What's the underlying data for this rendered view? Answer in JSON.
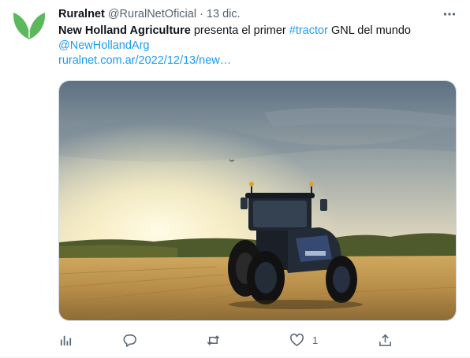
{
  "tweet": {
    "author_name": "Ruralnet",
    "handle": "@RuralNetOficial",
    "separator": "·",
    "date": "13 dic.",
    "text": {
      "bold": "New Holland Agriculture",
      "part1": " presenta el primer ",
      "hashtag": "#tractor",
      "part2": " GNL del mundo",
      "mention": "@NewHollandArg",
      "link": "ruralnet.com.ar/2022/12/13/new…"
    },
    "image_description_icon": "tractor-photo",
    "actions": {
      "like_count": "1"
    }
  },
  "colors": {
    "brand_green": "#5cb85c",
    "link_blue": "#1d9bf0",
    "muted": "#536471"
  },
  "icons": [
    "ruralnet-logo",
    "more-icon",
    "analytics-icon",
    "reply-icon",
    "retweet-icon",
    "like-icon",
    "share-icon"
  ]
}
